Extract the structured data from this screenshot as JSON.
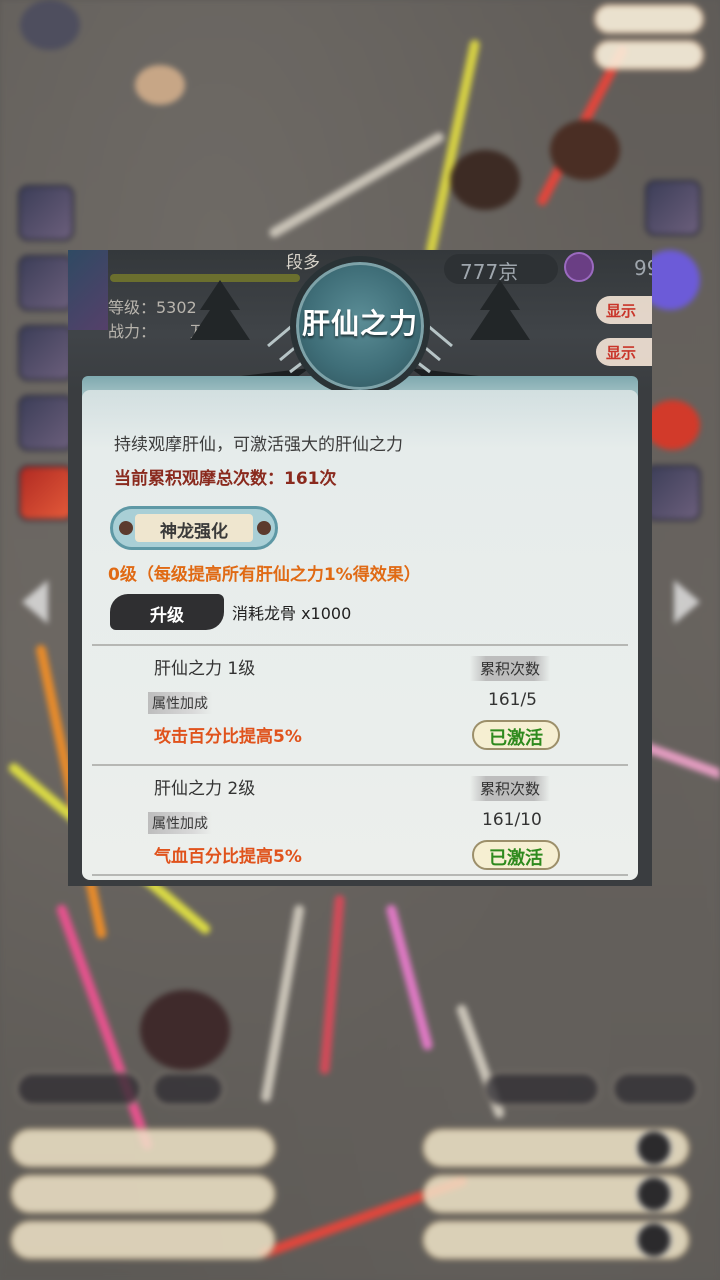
{
  "colors": {
    "title_teal": "#4f8089",
    "panel_bg": "#ecefec",
    "count_red": "#8a2a1e",
    "level_orange": "#e06a14",
    "attr_orange": "#e0531c",
    "activated_green": "#2e8a1e"
  },
  "frame": {
    "level_label": "等级：5302",
    "power_label": "战力：",
    "power_value": "万亿",
    "currency": "777京",
    "currency2": "99",
    "tag_top": "显示",
    "tag_bottom": "显示",
    "partial_name": "段多"
  },
  "modal": {
    "title": "肝仙之力",
    "description": "持续观摩肝仙，可激活强大的肝仙之力",
    "total_count": "当前累积观摩总次数：161次",
    "dragon_badge": "神龙强化",
    "level_info": "0级（每级提高所有肝仙之力1%得效果）",
    "upgrade_button": "升级",
    "cost": "消耗龙骨 x1000",
    "rows": [
      {
        "title": "肝仙之力 1级",
        "attr_label": "属性加成",
        "attr_value": "攻击百分比提高5%",
        "accum_label": "累积次数",
        "progress": "161/5",
        "status": "已激活"
      },
      {
        "title": "肝仙之力 2级",
        "attr_label": "属性加成",
        "attr_value": "气血百分比提高5%",
        "accum_label": "累积次数",
        "progress": "161/10",
        "status": "已激活"
      }
    ]
  },
  "icons": {
    "left_arrow": "chevron-left-icon",
    "right_arrow": "chevron-right-icon"
  }
}
